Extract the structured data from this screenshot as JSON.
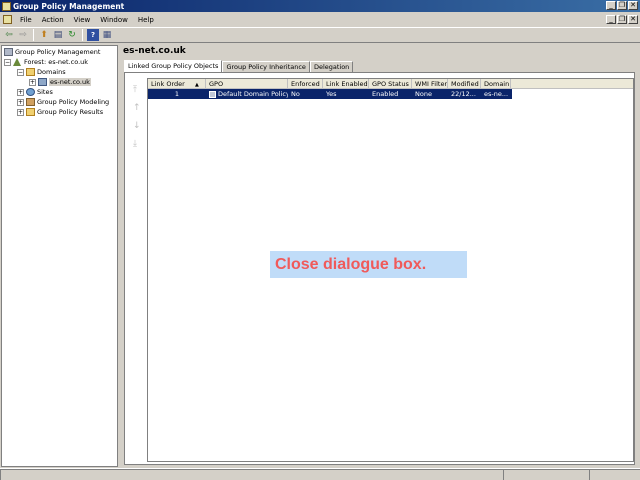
{
  "window": {
    "title": "Group Policy Management"
  },
  "menu": [
    "File",
    "Action",
    "View",
    "Window",
    "Help"
  ],
  "toolbar": [
    "back-icon",
    "forward-icon",
    "up-icon",
    "show-hide-tree-icon",
    "refresh-icon",
    "help-icon",
    "properties-icon"
  ],
  "tree": {
    "root": "Group Policy Management",
    "forest": "Forest: es-net.co.uk",
    "domains": "Domains",
    "domain": "es-net.co.uk",
    "sites": "Sites",
    "modeling": "Group Policy Modeling",
    "results": "Group Policy Results"
  },
  "pane": {
    "title": "es-net.co.uk",
    "tabs": [
      "Linked Group Policy Objects",
      "Group Policy Inheritance",
      "Delegation"
    ]
  },
  "table": {
    "headers": [
      "Link Order",
      "GPO",
      "Enforced",
      "Link Enabled",
      "GPO Status",
      "WMI Filter",
      "Modified",
      "Domain"
    ],
    "rows": [
      [
        "1",
        "Default Domain Policy",
        "No",
        "Yes",
        "Enabled",
        "None",
        "22/12...",
        "es-ne..."
      ]
    ],
    "sort_indicator": "▲"
  },
  "callout": {
    "text": "Close dialogue box."
  }
}
